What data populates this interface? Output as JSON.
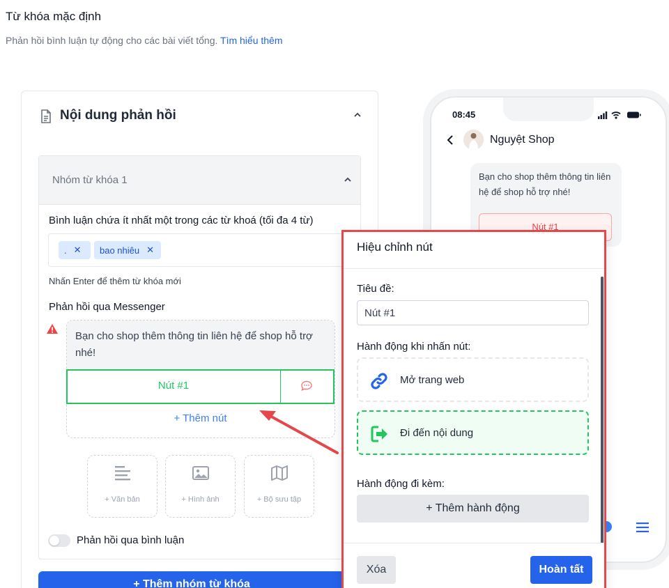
{
  "header": {
    "title": "Từ khóa mặc định",
    "subtitle": "Phản hồi bình luận tự động cho các bài viết tổng.",
    "learn_more": "Tìm hiểu thêm"
  },
  "card": {
    "title": "Nội dung phản hồi",
    "group": {
      "title": "Nhóm từ khóa 1",
      "keywords_label": "Bình luận chứa ít nhất một trong các từ khoá (tối đa 4 từ)",
      "tags": [
        ".",
        "bao nhiêu"
      ],
      "keywords_hint": "Nhấn Enter để thêm từ khóa mới",
      "messenger_label": "Phản hồi qua Messenger",
      "message_text": "Bạn cho shop thêm thông tin liên hệ để shop hỗ trợ nhé!",
      "button_label": "Nút #1",
      "add_button": "+ Thêm nút",
      "media": [
        {
          "label": "+ Văn bản",
          "icon": "text-align-icon"
        },
        {
          "label": "+ Hình ảnh",
          "icon": "image-icon"
        },
        {
          "label": "+ Bộ sưu tập",
          "icon": "map-icon"
        }
      ],
      "comment_reply_label": "Phản hồi qua bình luận",
      "comment_reply_enabled": false
    },
    "add_group_button": "+ Thêm nhóm từ khóa"
  },
  "phone": {
    "time": "08:45",
    "shop_name": "Nguyệt Shop",
    "message": "Bạn cho shop thêm thông tin liên hệ để shop hỗ trợ nhé!",
    "button_label": "Nút #1"
  },
  "dialog": {
    "title": "Hiệu chỉnh nút",
    "title_label": "Tiêu đề:",
    "title_value": "Nút #1",
    "action_label": "Hành động khi nhấn nút:",
    "options": [
      {
        "label": "Mở trang web",
        "icon": "link-icon",
        "selected": false
      },
      {
        "label": "Đi đến nội dung",
        "icon": "arrow-right-box-icon",
        "selected": true
      }
    ],
    "extra_label": "Hành động đi kèm:",
    "add_action": "+ Thêm hành động",
    "delete": "Xóa",
    "done": "Hoàn tất"
  },
  "colors": {
    "primary": "#2563eb",
    "success": "#22c55e",
    "highlight_border": "#e3494b",
    "warning": "#ef4444"
  }
}
